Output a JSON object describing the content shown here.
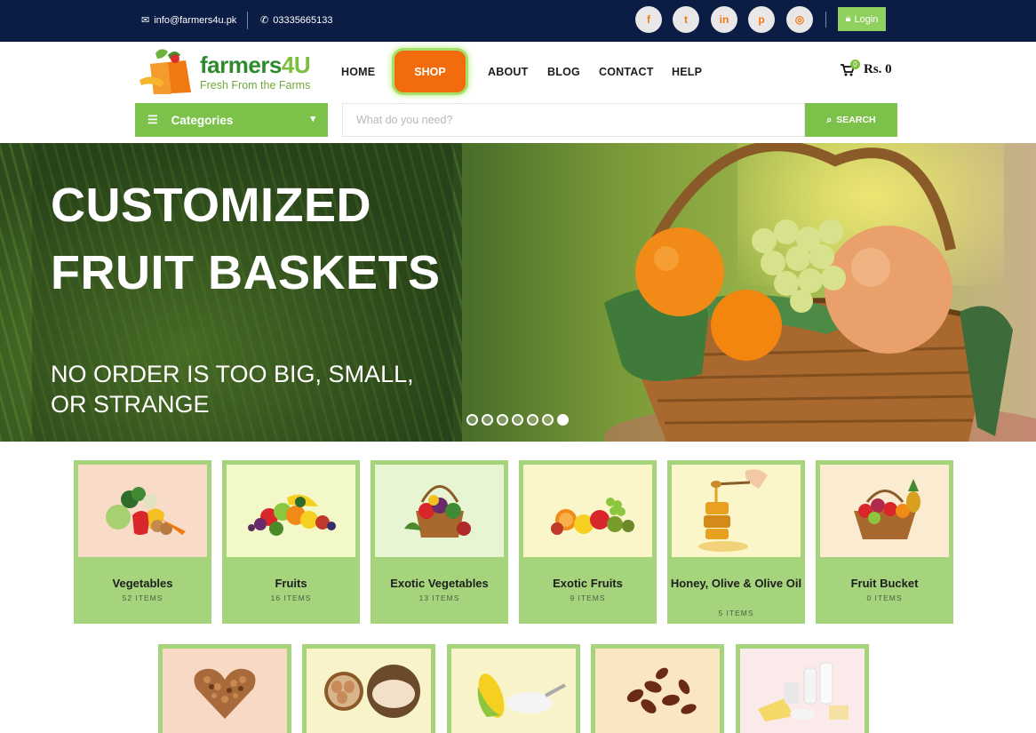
{
  "topbar": {
    "email": "info@farmers4u.pk",
    "phone": "03335665133",
    "login_label": "Login",
    "social": [
      {
        "icon": "facebook-icon",
        "glyph": "f"
      },
      {
        "icon": "twitter-icon",
        "glyph": "t"
      },
      {
        "icon": "linkedin-icon",
        "glyph": "in"
      },
      {
        "icon": "pinterest-icon",
        "glyph": "p"
      },
      {
        "icon": "instagram-icon",
        "glyph": "◎"
      }
    ]
  },
  "header": {
    "brand_main": "farmers",
    "brand_num": "4U",
    "tagline": "Fresh From the Farms",
    "nav": [
      "HOME",
      "SHOP",
      "ABOUT",
      "BLOG",
      "CONTACT",
      "HELP"
    ],
    "cart_count": "0",
    "cart_amount": "Rs. 0"
  },
  "search": {
    "categories_label": "Categories",
    "placeholder": "What do you need?",
    "button_label": "SEARCH"
  },
  "hero": {
    "title_line1": "CUSTOMIZED",
    "title_line2": "FRUIT BASKETS",
    "subtitle_line1": "NO ORDER IS TOO BIG, SMALL,",
    "subtitle_line2": "OR STRANGE",
    "slides_total": 7,
    "active_slide": 7
  },
  "categories": [
    {
      "name": "Vegetables",
      "count": "52 ITEMS",
      "bg": "#f9dcc8"
    },
    {
      "name": "Fruits",
      "count": "16 ITEMS",
      "bg": "#f3f8c8"
    },
    {
      "name": "Exotic Vegetables",
      "count": "13 ITEMS",
      "bg": "#e8f5d2"
    },
    {
      "name": "Exotic Fruits",
      "count": "9 ITEMS",
      "bg": "#fbf6c9"
    },
    {
      "name": "Honey, Olive & Olive Oil",
      "count": "5 ITEMS",
      "bg": "#fbf6c9"
    },
    {
      "name": "Fruit Bucket",
      "count": "0 ITEMS",
      "bg": "#fbebd0"
    }
  ],
  "categories_row2": [
    {
      "bg": "#f8d9c6"
    },
    {
      "bg": "#f8f3c8"
    },
    {
      "bg": "#f8f3c8"
    },
    {
      "bg": "#fae7c2"
    },
    {
      "bg": "#fbeaea"
    }
  ],
  "colors": {
    "topbar": "#0b1c45",
    "accent_green": "#7cc24a",
    "shop_orange": "#f26b0c",
    "tile_border": "#a5d47c"
  }
}
